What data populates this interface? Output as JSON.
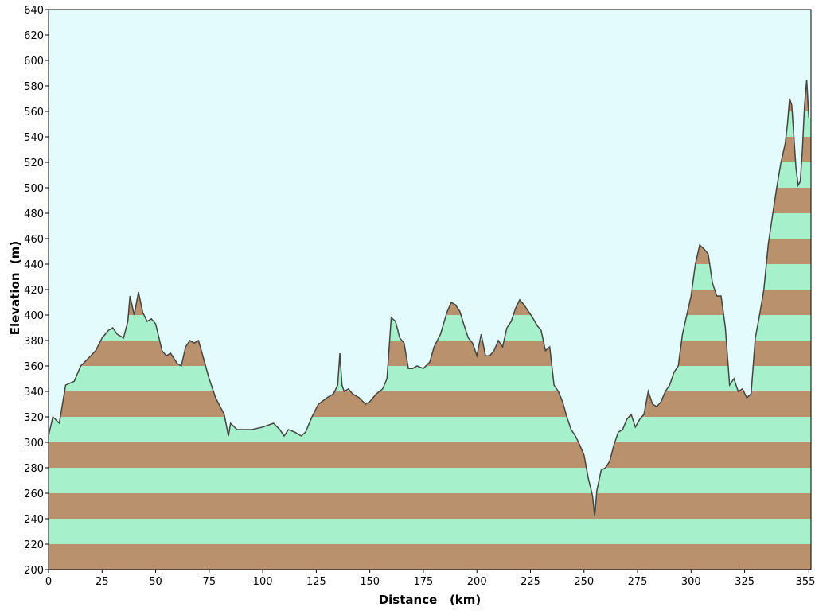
{
  "chart_data": {
    "type": "area",
    "xlabel": "Distance   (km)",
    "ylabel": "Elevation  (m)",
    "xlim": [
      0,
      356
    ],
    "ylim": [
      200,
      640
    ],
    "x_ticks": [
      0,
      25,
      50,
      75,
      100,
      125,
      150,
      175,
      200,
      225,
      250,
      275,
      300,
      325,
      355
    ],
    "y_ticks": [
      200,
      220,
      240,
      260,
      280,
      300,
      320,
      340,
      360,
      380,
      400,
      420,
      440,
      460,
      480,
      500,
      520,
      540,
      560,
      580,
      600,
      620,
      640
    ],
    "band_size": 20,
    "grid": false,
    "legend": "none",
    "colors": {
      "background": "#e4fbfb",
      "band_light": "#a6f0cc",
      "band_dark": "#b9916c",
      "line": "#444444"
    },
    "series": [
      {
        "x": [
          0,
          2,
          5,
          8,
          12,
          15,
          18,
          22,
          25,
          28,
          30,
          32,
          35,
          37,
          38,
          40,
          42,
          44,
          46,
          48,
          50,
          53,
          55,
          57,
          60,
          62,
          64,
          66,
          68,
          70,
          72,
          75,
          78,
          82,
          84,
          85,
          88,
          92,
          95,
          100,
          105,
          108,
          110,
          112,
          115,
          118,
          120,
          123,
          126,
          130,
          133,
          135,
          136,
          137,
          138,
          140,
          142,
          145,
          148,
          150,
          153,
          156,
          158,
          160,
          162,
          164,
          166,
          168,
          170,
          172,
          175,
          178,
          180,
          183,
          186,
          188,
          190,
          192,
          194,
          196,
          198,
          200,
          202,
          204,
          206,
          208,
          210,
          212,
          214,
          216,
          218,
          220,
          222,
          224,
          226,
          228,
          230,
          232,
          234,
          236,
          238,
          240,
          242,
          244,
          246,
          248,
          250,
          252,
          253,
          254,
          255,
          256,
          258,
          260,
          262,
          264,
          266,
          268,
          270,
          272,
          274,
          276,
          278,
          280,
          282,
          284,
          286,
          288,
          290,
          292,
          294,
          296,
          298,
          300,
          302,
          304,
          306,
          308,
          310,
          312,
          314,
          316,
          318,
          320,
          322,
          324,
          326,
          328,
          330,
          332,
          334,
          336,
          338,
          340,
          342,
          344,
          345,
          346,
          347,
          348,
          349,
          350,
          351,
          352,
          353,
          354,
          355
        ],
        "y": [
          305,
          320,
          315,
          345,
          348,
          360,
          365,
          372,
          382,
          388,
          390,
          385,
          382,
          395,
          415,
          400,
          418,
          402,
          395,
          397,
          393,
          372,
          368,
          370,
          362,
          360,
          375,
          380,
          378,
          380,
          368,
          350,
          335,
          322,
          305,
          315,
          310,
          310,
          310,
          312,
          315,
          310,
          305,
          310,
          308,
          305,
          308,
          320,
          330,
          335,
          338,
          345,
          370,
          345,
          340,
          342,
          338,
          335,
          330,
          332,
          338,
          342,
          350,
          398,
          395,
          382,
          378,
          358,
          358,
          360,
          358,
          363,
          375,
          385,
          402,
          410,
          408,
          403,
          392,
          382,
          378,
          368,
          385,
          368,
          368,
          372,
          380,
          375,
          390,
          395,
          405,
          412,
          408,
          403,
          398,
          392,
          388,
          372,
          375,
          345,
          340,
          332,
          320,
          310,
          305,
          298,
          290,
          272,
          265,
          258,
          242,
          262,
          278,
          280,
          285,
          298,
          308,
          310,
          318,
          322,
          312,
          318,
          322,
          340,
          330,
          328,
          332,
          340,
          345,
          355,
          360,
          385,
          400,
          415,
          440,
          455,
          452,
          448,
          425,
          415,
          415,
          390,
          345,
          350,
          340,
          342,
          335,
          338,
          382,
          400,
          420,
          455,
          478,
          500,
          520,
          535,
          550,
          570,
          565,
          540,
          515,
          502,
          505,
          530,
          565,
          585,
          555
        ]
      }
    ]
  }
}
